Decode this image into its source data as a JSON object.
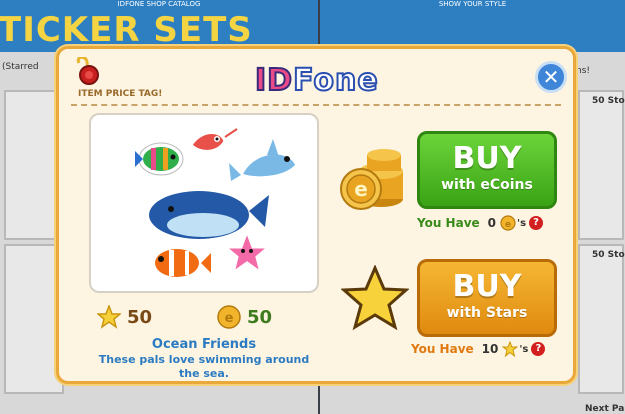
{
  "background": {
    "top_left": "IDFONE SHOP CATALOG",
    "top_right": "SHOW YOUR STYLE",
    "title": "TICKER SETS",
    "starred_note": "(Starred",
    "right_note": "ns!",
    "stock_1": "50 Sto",
    "stock_2": "50 Sto",
    "next_page": "Next Pa"
  },
  "modal": {
    "price_tag_label": "ITEM PRICE TAG!",
    "logo_id": "ID",
    "logo_fone": "Fone",
    "close_icon": "close-icon",
    "item": {
      "name": "Ocean Friends",
      "description": "These pals love swimming around the sea.",
      "price_stars": "50",
      "price_ecoins": "50"
    },
    "buy_ecoins": {
      "big": "BUY",
      "small": "with eCoins",
      "have_label": "You Have",
      "have_value": "0",
      "suffix": "'s",
      "help": "?"
    },
    "buy_stars": {
      "big": "BUY",
      "small": "with Stars",
      "have_label": "You Have",
      "have_value": "10",
      "suffix": "'s",
      "help": "?"
    }
  },
  "colors": {
    "modal_bg": "#fdf5e2",
    "modal_border": "#e8a93a",
    "ecoin_button": "#3aa315",
    "star_button": "#e08a10",
    "item_text": "#2c7bc2"
  }
}
